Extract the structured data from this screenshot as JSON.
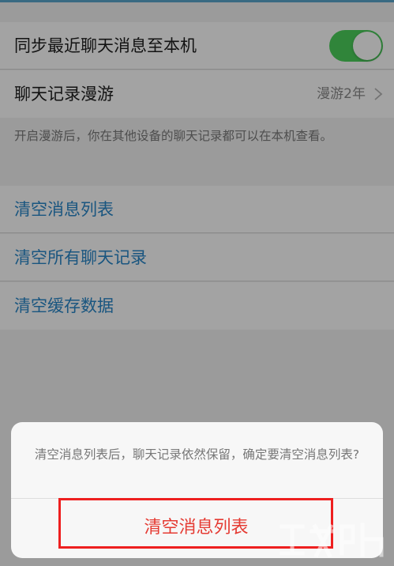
{
  "settings": {
    "sync_label": "同步最近聊天消息至本机",
    "sync_enabled": true,
    "roaming_label": "聊天记录漫游",
    "roaming_value": "漫游2年",
    "roaming_description": "开启漫游后，你在其他设备的聊天记录都可以在本机查看。",
    "clear_message_list_label": "清空消息列表",
    "clear_all_history_label": "清空所有聊天记录",
    "clear_cache_label": "清空缓存数据"
  },
  "dialog": {
    "message": "清空消息列表后，聊天记录依然保留，确定要清空消息列表?",
    "confirm_label": "清空消息列表"
  },
  "colors": {
    "toggle_on": "#4cd05c",
    "link_blue": "#2a87c8",
    "destructive_red": "#e53b33",
    "highlight_box": "#ee1f1f"
  },
  "icons": {
    "roaming_chevron": "chevron-right-icon",
    "watermark": "site-logo-watermark"
  }
}
